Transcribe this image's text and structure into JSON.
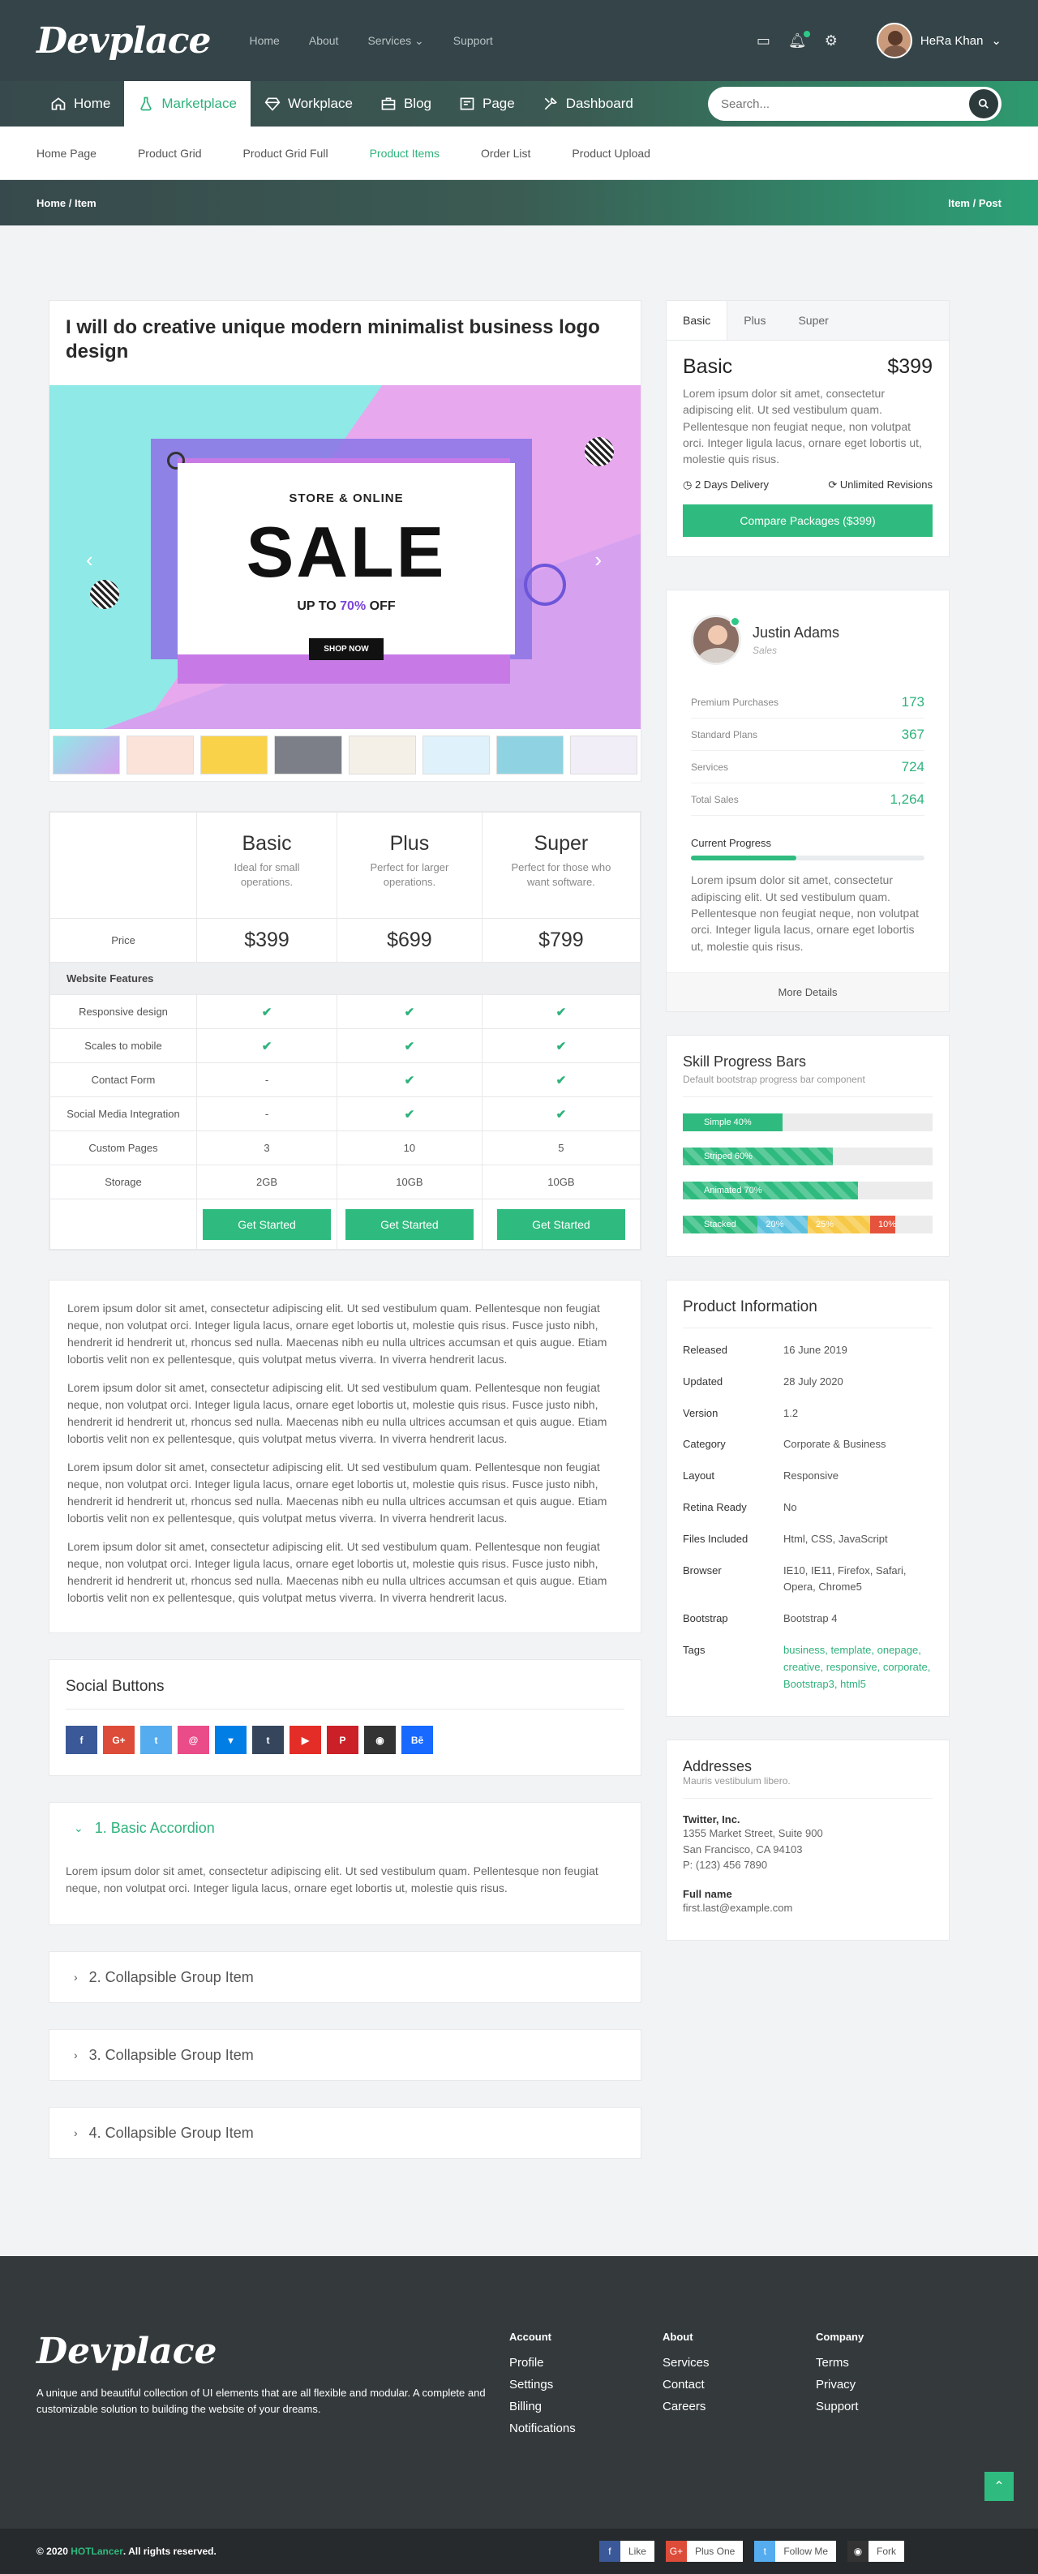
{
  "header": {
    "logo": "Devplace",
    "topnav": [
      "Home",
      "About",
      "Services",
      "Support"
    ],
    "user_name": "HeRa Khan"
  },
  "mainnav": {
    "items": [
      {
        "label": "Home",
        "icon": "home-icon"
      },
      {
        "label": "Marketplace",
        "icon": "flask-icon"
      },
      {
        "label": "Workplace",
        "icon": "diamond-icon"
      },
      {
        "label": "Blog",
        "icon": "briefcase-icon"
      },
      {
        "label": "Page",
        "icon": "news-icon"
      },
      {
        "label": "Dashboard",
        "icon": "tools-icon"
      }
    ],
    "search_placeholder": "Search..."
  },
  "subnav": [
    "Home Page",
    "Product Grid",
    "Product Grid Full",
    "Product Items",
    "Order List",
    "Product Upload"
  ],
  "breadcrumb": {
    "left": "Home / Item",
    "right": "Item / Post"
  },
  "product": {
    "title": "I will do creative unique modern minimalist business logo design",
    "hero": {
      "top": "STORE & ONLINE",
      "big": "SALE",
      "upto_a": "UP TO ",
      "upto_b": "70%",
      "upto_c": " OFF",
      "btn": "SHOP NOW"
    }
  },
  "pricing": {
    "plans": [
      {
        "name": "Basic",
        "desc": "Ideal for small operations.",
        "price": "$399"
      },
      {
        "name": "Plus",
        "desc": "Perfect for larger operations.",
        "price": "$699"
      },
      {
        "name": "Super",
        "desc": "Perfect for those who want software.",
        "price": "$799"
      }
    ],
    "price_label": "Price",
    "section": "Website Features",
    "features": [
      {
        "label": "Responsive design",
        "v": [
          "✔",
          "✔",
          "✔"
        ]
      },
      {
        "label": "Scales to mobile",
        "v": [
          "✔",
          "✔",
          "✔"
        ]
      },
      {
        "label": "Contact Form",
        "v": [
          "-",
          "✔",
          "✔"
        ]
      },
      {
        "label": "Social Media Integration",
        "v": [
          "-",
          "✔",
          "✔"
        ]
      },
      {
        "label": "Custom Pages",
        "v": [
          "3",
          "10",
          "5"
        ]
      },
      {
        "label": "Storage",
        "v": [
          "2GB",
          "10GB",
          "10GB"
        ]
      }
    ],
    "btn": "Get Started"
  },
  "lorem": "Lorem ipsum dolor sit amet, consectetur adipiscing elit. Ut sed vestibulum quam. Pellentesque non feugiat neque, non volutpat orci. Integer ligula lacus, ornare eget lobortis ut, molestie quis risus. Fusce justo nibh, hendrerit id hendrerit ut, rhoncus sed nulla. Maecenas nibh eu nulla ultrices accumsan et quis augue. Etiam lobortis velit non ex pellentesque, quis volutpat metus viverra. In viverra hendrerit lacus.",
  "social": {
    "title": "Social Buttons",
    "buttons": [
      {
        "icon": "facebook-icon",
        "glyph": "f",
        "color": "#3b5998"
      },
      {
        "icon": "google-plus-icon",
        "glyph": "G+",
        "color": "#dd4b39"
      },
      {
        "icon": "twitter-icon",
        "glyph": "t",
        "color": "#55acee"
      },
      {
        "icon": "dribbble-icon",
        "glyph": "@",
        "color": "#ea4c89"
      },
      {
        "icon": "dropbox-icon",
        "glyph": "▾",
        "color": "#007ee5"
      },
      {
        "icon": "tumblr-icon",
        "glyph": "t",
        "color": "#35465c"
      },
      {
        "icon": "youtube-icon",
        "glyph": "▶",
        "color": "#e52d27"
      },
      {
        "icon": "pinterest-icon",
        "glyph": "P",
        "color": "#cb2027"
      },
      {
        "icon": "github-icon",
        "glyph": "◉",
        "color": "#333333"
      },
      {
        "icon": "behance-icon",
        "glyph": "Bē",
        "color": "#1769ff"
      }
    ]
  },
  "accordion": {
    "items": [
      "1. Basic Accordion",
      "2. Collapsible Group Item",
      "3. Collapsible Group Item",
      "4. Collapsible Group Item"
    ],
    "body": "Lorem ipsum dolor sit amet, consectetur adipiscing elit. Ut sed vestibulum quam. Pellentesque non feugiat neque, non volutpat orci. Integer ligula lacus, ornare eget lobortis ut, molestie quis risus."
  },
  "package": {
    "tabs": [
      "Basic",
      "Plus",
      "Super"
    ],
    "name": "Basic",
    "price": "$399",
    "desc": "Lorem ipsum dolor sit amet, consectetur adipiscing elit. Ut sed vestibulum quam. Pellentesque non feugiat neque, non volutpat orci. Integer ligula lacus, ornare eget lobortis ut, molestie quis risus.",
    "delivery": "2 Days Delivery",
    "revisions": "Unlimited Revisions",
    "btn": "Compare Packages ($399)"
  },
  "profile": {
    "name": "Justin Adams",
    "role": "Sales",
    "stats": [
      {
        "label": "Premium Purchases",
        "value": "173"
      },
      {
        "label": "Standard Plans",
        "value": "367"
      },
      {
        "label": "Services",
        "value": "724"
      },
      {
        "label": "Total Sales",
        "value": "1,264"
      }
    ],
    "progress_label": "Current Progress",
    "progress": 0.45,
    "desc": "Lorem ipsum dolor sit amet, consectetur adipiscing elit. Ut sed vestibulum quam. Pellentesque non feugiat neque, non volutpat orci. Integer ligula lacus, ornare eget lobortis ut, molestie quis risus.",
    "more": "More Details"
  },
  "skills": {
    "title": "Skill Progress Bars",
    "sub": "Default bootstrap progress bar component",
    "bars": [
      {
        "segments": [
          {
            "label": "Simple 40%",
            "pct": 40,
            "color": "#2fbb7f",
            "striped": false
          }
        ]
      },
      {
        "segments": [
          {
            "label": "Striped 60%",
            "pct": 60,
            "color": "#2fbb7f",
            "striped": true
          }
        ]
      },
      {
        "segments": [
          {
            "label": "Animated 70%",
            "pct": 70,
            "color": "#2fbb7f",
            "striped": true
          }
        ]
      },
      {
        "segments": [
          {
            "label": "Stacked",
            "pct": 30,
            "color": "#2fbb7f",
            "striped": true
          },
          {
            "label": "20%",
            "pct": 20,
            "color": "#5bc0de",
            "striped": true
          },
          {
            "label": "25%",
            "pct": 25,
            "color": "#f7c948",
            "striped": true
          },
          {
            "label": "10%",
            "pct": 10,
            "color": "#e5533d",
            "striped": false
          }
        ]
      }
    ]
  },
  "info": {
    "title": "Product Information",
    "rows": [
      {
        "k": "Released",
        "v": "16 June 2019"
      },
      {
        "k": "Updated",
        "v": "28 July 2020"
      },
      {
        "k": "Version",
        "v": "1.2"
      },
      {
        "k": "Category",
        "v": "Corporate & Business"
      },
      {
        "k": "Layout",
        "v": "Responsive"
      },
      {
        "k": "Retina Ready",
        "v": "No"
      },
      {
        "k": "Files Included",
        "v": "Html, CSS, JavaScript"
      },
      {
        "k": "Browser",
        "v": "IE10, IE11, Firefox, Safari, Opera, Chrome5"
      },
      {
        "k": "Bootstrap",
        "v": "Bootstrap 4"
      },
      {
        "k": "Tags",
        "v": "business, template, onepage, creative, responsive, corporate, Bootstrap3, html5"
      }
    ]
  },
  "address": {
    "title": "Addresses",
    "sub": "Mauris vestibulum libero.",
    "company": "Twitter, Inc.",
    "line1": "1355 Market Street, Suite 900",
    "line2": "San Francisco, CA 94103",
    "phone": "P: (123) 456 7890",
    "fullname_label": "Full name",
    "email": "first.last@example.com"
  },
  "footer": {
    "logo": "Devplace",
    "desc": "A unique and beautiful collection of UI elements that are all flexible and modular. A complete and customizable solution to building the website of your dreams.",
    "cols": [
      {
        "title": "Account",
        "links": [
          "Profile",
          "Settings",
          "Billing",
          "Notifications"
        ]
      },
      {
        "title": "About",
        "links": [
          "Services",
          "Contact",
          "Careers"
        ]
      },
      {
        "title": "Company",
        "links": [
          "Terms",
          "Privacy",
          "Support"
        ]
      }
    ],
    "copy_a": "© 2020 ",
    "copy_b": "HOTLancer",
    "copy_c": ". All rights reserved.",
    "share": [
      {
        "icon": "facebook-icon",
        "glyph": "f",
        "text": "Like",
        "color": "#3b5998"
      },
      {
        "icon": "google-plus-icon",
        "glyph": "G+",
        "text": "Plus One",
        "color": "#dd4b39"
      },
      {
        "icon": "twitter-icon",
        "glyph": "t",
        "text": "Follow Me",
        "color": "#55acee"
      },
      {
        "icon": "github-icon",
        "glyph": "◉",
        "text": "Fork",
        "color": "#333333"
      }
    ]
  }
}
